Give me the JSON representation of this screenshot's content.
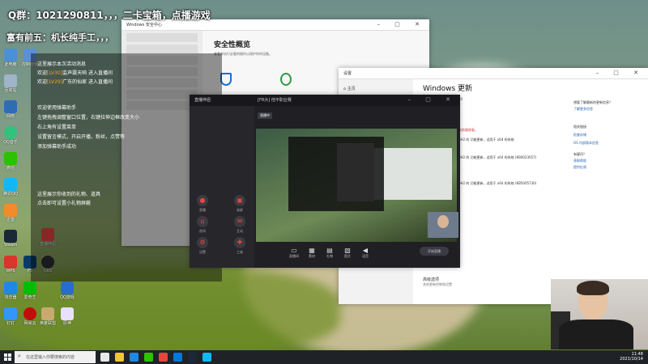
{
  "banner": {
    "line1": "Q群：1021290811，，，二卡宝箱，点播游戏",
    "line2": "富有前五：机长纯手工，，，"
  },
  "chat_overlay": {
    "lines": [
      {
        "pre": "",
        "hl": "",
        "post": "这里展示本次活动消息"
      },
      {
        "pre": "欢迎",
        "hl": "[LV30]",
        "post": "监声震天响 进入直播间"
      },
      {
        "pre": "欢迎",
        "hl": "[LV29]",
        "post": "广东的仙家 进入直播间"
      },
      {
        "pre": "",
        "hl": "",
        "post": "欢迎使用弹幕助手"
      },
      {
        "pre": "",
        "hl": "",
        "post": "左键拖拽调整窗口位置，右键拉伸边框改变大小"
      },
      {
        "pre": "",
        "hl": "",
        "post": "右上角有设置菜单"
      },
      {
        "pre": "",
        "hl": "",
        "post": "设置留言模式，开启开播，粉丝，点赞等"
      },
      {
        "pre": "",
        "hl": "",
        "post": "添加弹幕助手成功"
      },
      {
        "pre": "",
        "hl": "",
        "post": "这里展示你收到的礼物、道具"
      },
      {
        "pre": "",
        "hl": "",
        "post": "点击即可设置小礼物屏蔽"
      }
    ]
  },
  "settings_window": {
    "title_bar": "Windows 安全中心",
    "title": "安全性概览",
    "subtitle": "查看并执行必要的操作以保护你的设备。"
  },
  "update_window": {
    "title_bar": "设置",
    "nav_home": "主页",
    "heading": "Windows 更新",
    "time": "上次检查时间：今天，7:30",
    "warning": "你的设备缺少重要的安全和质量修复。",
    "updates": [
      "Windows 10 Version 20H2 的 功能更新，适用于 x64 的系统",
      "Windows 10 Version 20H2 的 功能更新，适用于 x64 的系统 (KB4023057)",
      "Windows 10 Version 20H2 的 功能更新，适用于 x64 的系统 (KB5005730)"
    ],
    "right_links": [
      "想要了解最新的更新信息？",
      "了解更多信息",
      "相关链接",
      "检查存储",
      "OS 内部版本信息",
      "有疑问？",
      "获取帮助",
      "提供反馈"
    ],
    "more": "更改使用时段",
    "advanced": "高级选项",
    "advanced_sub": "其他更新控制和设置"
  },
  "stream_client": {
    "brand": "直播伴侣",
    "room": "[FR大] 他平职业赛",
    "live_badge": "直播中",
    "start": "开始直播",
    "left_items": [
      "直播",
      "录屏",
      "房间",
      "互动",
      "设置",
      "工具"
    ],
    "bottom_buttons": [
      "直播间",
      "素材",
      "礼物",
      "图文",
      "语音"
    ]
  },
  "taskbar": {
    "search_placeholder": "在这里输入你要搜索的内容",
    "time": "11:48",
    "date": "2021/10/14"
  },
  "desktop": {
    "icons": [
      "此电脑",
      "回收站",
      "网络",
      "QQ音乐",
      "微信",
      "腾讯QQ",
      "迅雷",
      "Steam",
      "WPS",
      "浏览器",
      "控制面板",
      "爱奇艺",
      "OBS",
      "直播伴侣",
      "PS",
      "网易云",
      "钉钉",
      "英雄联盟",
      "原神",
      "QQ游戏"
    ]
  }
}
